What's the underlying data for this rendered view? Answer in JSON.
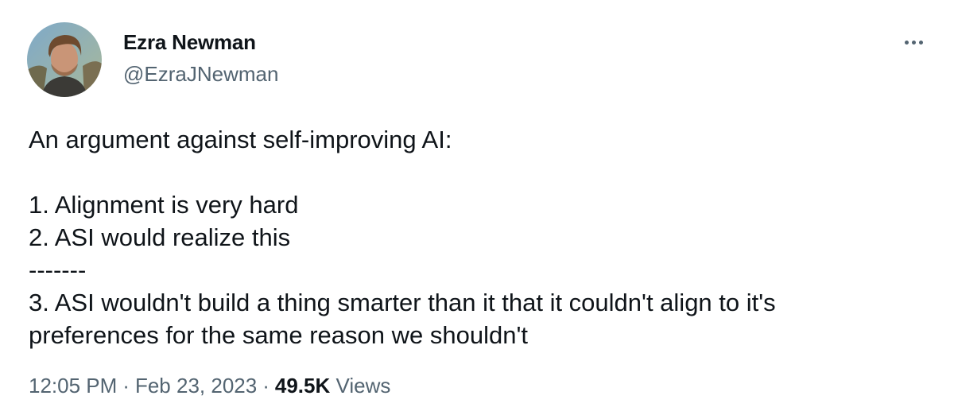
{
  "tweet": {
    "author": {
      "name": "Ezra Newman",
      "handle": "@EzraJNewman",
      "avatar_icon": "profile-photo"
    },
    "more_icon": "more-horizontal-icon",
    "lines": [
      "An argument against self-improving AI:",
      "",
      "1. Alignment is very hard",
      "2. ASI would realize this",
      "-------",
      "3. ASI wouldn't build a thing smarter than it that it couldn't align to it's",
      "preferences for the same reason we shouldn't"
    ],
    "time": "12:05 PM",
    "date": "Feb 23, 2023",
    "separator": "·",
    "views_count": "49.5K",
    "views_label": "Views"
  },
  "colors": {
    "text_primary": "#0f1419",
    "text_secondary": "#536471",
    "background": "#ffffff"
  }
}
